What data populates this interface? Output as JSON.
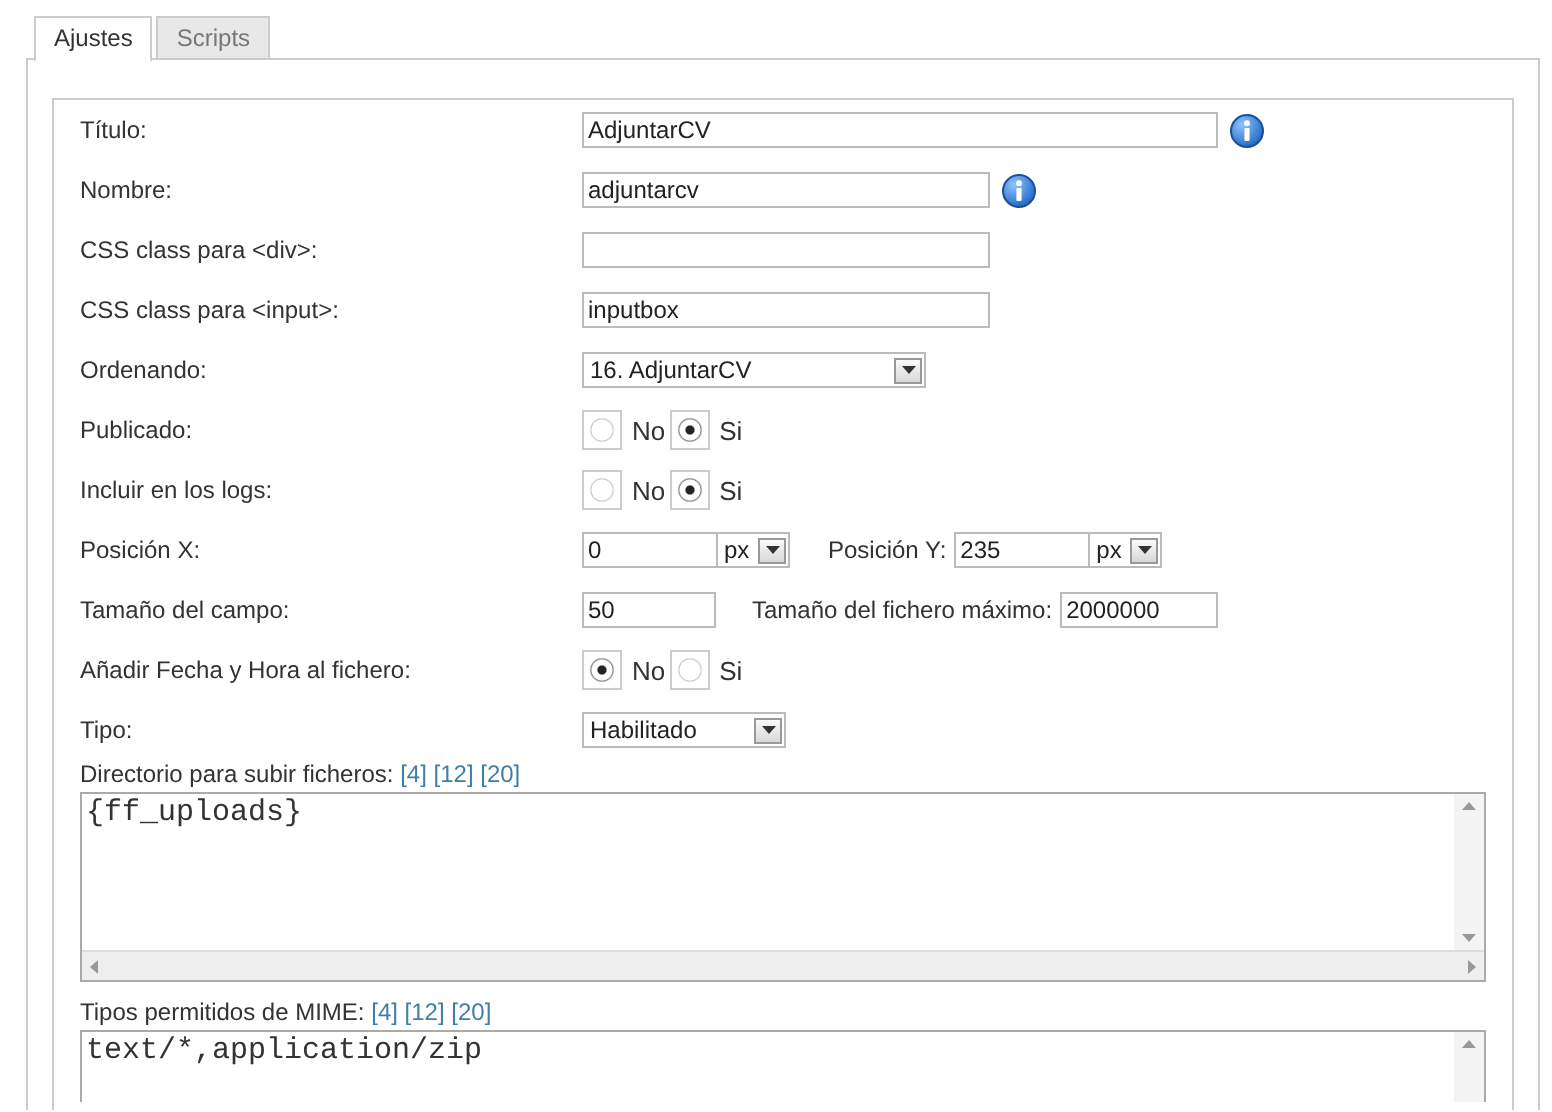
{
  "tabs": [
    {
      "label": "Ajustes",
      "selected": true
    },
    {
      "label": "Scripts",
      "selected": false
    }
  ],
  "fields": [
    {
      "kind": "wide-text",
      "label": "Título:",
      "value": "AdjuntarCV",
      "info": true
    },
    {
      "kind": "text",
      "label": "Nombre:",
      "value": "adjuntarcv",
      "info": true
    },
    {
      "kind": "text",
      "label": "CSS class para <div>:",
      "info": false
    },
    {
      "kind": "text",
      "label": "CSS class para <input>:",
      "value": "inputbox",
      "info": false
    },
    {
      "kind": "select",
      "label": "Ordenando:",
      "value": "16. AdjuntarCV"
    },
    {
      "kind": "radio",
      "label": "Publicado:",
      "options": [
        {
          "label": "No",
          "selected": false
        },
        {
          "label": "Si",
          "selected": true
        }
      ]
    },
    {
      "kind": "radio",
      "label": "Incluir en los logs:",
      "options": [
        {
          "label": "No",
          "selected": false
        },
        {
          "label": "Si",
          "selected": true
        }
      ]
    },
    {
      "kind": "position",
      "label": "Posición X:",
      "value": "0",
      "unit": "px",
      "second_label": "Posición Y:",
      "second_value": "235",
      "second_unit": "px"
    },
    {
      "kind": "size",
      "label": "Tamaño del campo:",
      "value": "50",
      "second_label": "Tamaño del fichero máximo:",
      "second_value": "2000000"
    },
    {
      "kind": "radio",
      "label": "Añadir Fecha y Hora al fichero:",
      "options": [
        {
          "label": "No",
          "selected": true
        },
        {
          "label": "Si",
          "selected": false
        }
      ]
    },
    {
      "kind": "short-select",
      "label": "Tipo:",
      "value": "Habilitado"
    },
    {
      "kind": "textarea",
      "label": "Directorio para subir ficheros:",
      "links": [
        "[4]",
        "[12]",
        "[20]"
      ],
      "value": "{ff_uploads}"
    },
    {
      "kind": "textarea-cut",
      "label": "Tipos permitidos de MIME:",
      "links": [
        "[4]",
        "[12]",
        "[20]"
      ],
      "value": "text/*,application/zip"
    }
  ]
}
